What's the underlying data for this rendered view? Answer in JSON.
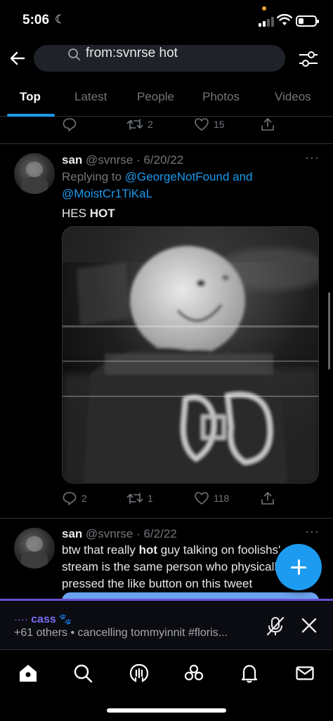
{
  "status": {
    "time": "5:06",
    "focus_icon": "moon-icon",
    "battery_level": 0.3
  },
  "search": {
    "query": "from:svnrse hot"
  },
  "tabs": [
    {
      "label": "Top",
      "active": true
    },
    {
      "label": "Latest",
      "active": false
    },
    {
      "label": "People",
      "active": false
    },
    {
      "label": "Photos",
      "active": false
    },
    {
      "label": "Videos",
      "active": false
    }
  ],
  "prev_tweet": {
    "retweets": "2",
    "likes": "15"
  },
  "tweets": [
    {
      "name": "san",
      "handle": "@svnrse",
      "date": "· 6/20/22",
      "replying_prefix": "Replying to ",
      "mention_1": "@GeorgeNotFound",
      "mention_joiner": " and",
      "mention_2": "@MoistCr1TiKaL",
      "text_before": "HES ",
      "text_bold": "HOT",
      "replies": "2",
      "retweets": "1",
      "likes": "118"
    },
    {
      "name": "san",
      "handle": "@svnrse",
      "date": "· 6/2/22",
      "line1_before": "btw that really ",
      "line1_bold": "hot",
      "line1_after": " guy talking on foolishs'",
      "line2": "stream is the same person who physicall",
      "line3": "pressed the like button on this tweet"
    }
  ],
  "space": {
    "host_prefix": "····",
    "host": "cass",
    "host_emoji": "🐾",
    "subtitle": "+61 others • cancelling tommyinnit #floris..."
  },
  "nav": [
    "home-icon",
    "search-icon",
    "spaces-icon",
    "communities-icon",
    "notifications-icon",
    "messages-icon"
  ],
  "colors": {
    "accent": "#1d9bf0",
    "spaces": "#7a6ef0"
  }
}
